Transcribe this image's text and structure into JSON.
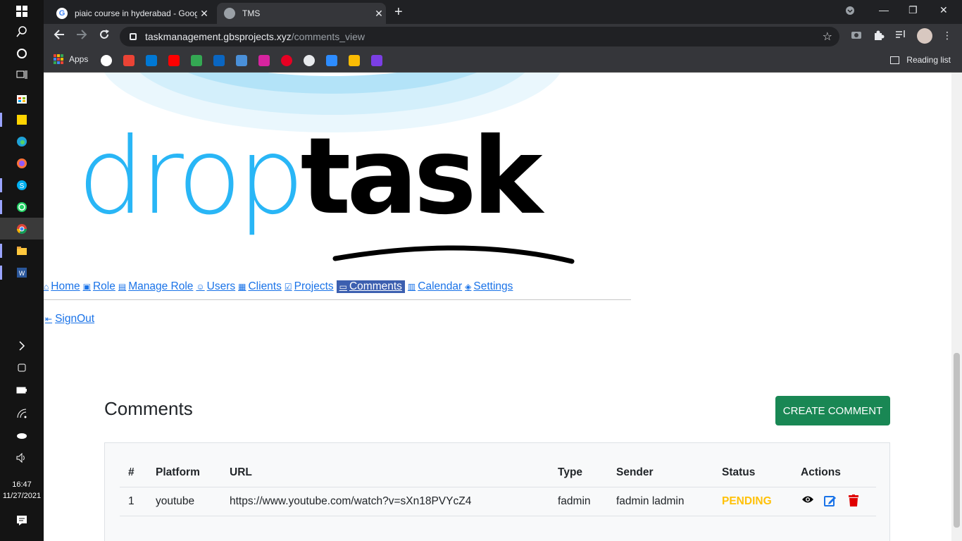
{
  "taskbar": {
    "time": "16:47",
    "date": "11/27/2021"
  },
  "browser": {
    "tabs": [
      {
        "title": "piaic course in hyderabad - Goog",
        "active": false
      },
      {
        "title": "TMS",
        "active": true
      }
    ],
    "url_host": "taskmanagement.gbsprojects.xyz",
    "url_path": "/comments_view",
    "bookmarks_apps_label": "Apps",
    "reading_list_label": "Reading list"
  },
  "logo": {
    "text_light": "drop",
    "text_bold": "task",
    "light_color": "#29b6f6",
    "bold_color": "#000000"
  },
  "nav": {
    "items": [
      {
        "label": "Home",
        "icon": "home-icon"
      },
      {
        "label": "Role",
        "icon": "role-icon"
      },
      {
        "label": "Manage Role",
        "icon": "manage-role-icon"
      },
      {
        "label": "Users",
        "icon": "user-icon"
      },
      {
        "label": "Clients",
        "icon": "clients-icon"
      },
      {
        "label": "Projects",
        "icon": "projects-icon"
      },
      {
        "label": "Comments",
        "icon": "comments-icon"
      },
      {
        "label": "Calendar",
        "icon": "calendar-icon"
      },
      {
        "label": "Settings",
        "icon": "settings-icon"
      }
    ],
    "signout": "SignOut"
  },
  "page": {
    "title": "Comments",
    "create_button": "CREATE COMMENT"
  },
  "table": {
    "headers": [
      "#",
      "Platform",
      "URL",
      "Type",
      "Sender",
      "Status",
      "Actions"
    ],
    "rows": [
      {
        "id": "1",
        "platform": "youtube",
        "url": "https://www.youtube.com/watch?v=sXn18PVYcZ4",
        "type": "fadmin",
        "sender": "fadmin ladmin",
        "status": "PENDING"
      }
    ]
  },
  "colors": {
    "accent": "#1a73e8",
    "success": "#198754",
    "pending": "#ffc107",
    "danger": "#e00000"
  }
}
